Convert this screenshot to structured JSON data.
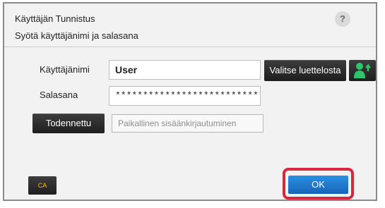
{
  "dialog": {
    "title": "Käyttäjän Tunnistus",
    "subtitle": "Syötä käyttäjänimi ja salasana",
    "help_label": "?"
  },
  "username": {
    "label": "Käyttäjänimi",
    "value": "User",
    "select_button_label": "Valitse luettelosta",
    "user_icon": "user-add-icon"
  },
  "password": {
    "label": "Salasana",
    "value": "***************************..."
  },
  "auth": {
    "authenticated_button_label": "Todennettu",
    "local_login_label": "Paikallinen sisäänkirjautuminen"
  },
  "footer": {
    "ca_label": "CA",
    "ok_label": "OK"
  },
  "colors": {
    "ok_highlight": "#d8283e",
    "ok_button": "#1f7bd0",
    "ca_text": "#f3c400",
    "user_icon_green": "#2fc36a"
  }
}
